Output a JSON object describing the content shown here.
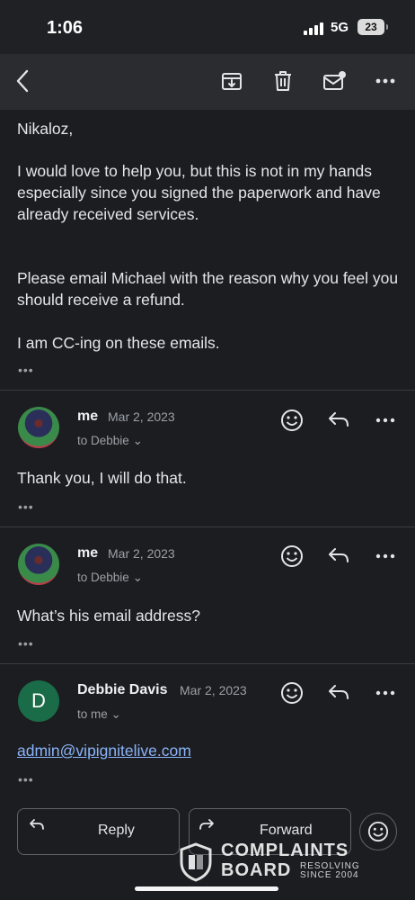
{
  "status_bar": {
    "time": "1:06",
    "network": "5G",
    "battery": "23"
  },
  "toolbar": {
    "back_icon": "chevron-left-icon",
    "archive_icon": "archive-icon",
    "delete_icon": "trash-icon",
    "mark_unread_icon": "mail-unread-icon",
    "more_icon": "more-horizontal-icon"
  },
  "first_message": {
    "lines": [
      "Nikaloz,",
      "I would love to help you, but this is not in my hands especially since you signed the paperwork and have already received services.",
      "Please email Michael with the reason why you feel you should receive a refund.",
      "I am CC-ing on these emails."
    ]
  },
  "messages": [
    {
      "sender": "me",
      "date": "Mar 2, 2023",
      "recipient": "to Debbie",
      "body": "Thank you, I will do that."
    },
    {
      "sender": "me",
      "date": "Mar 2, 2023",
      "recipient": "to Debbie",
      "body": "What’s his email address?"
    },
    {
      "sender": "Debbie Davis",
      "avatar_letter": "D",
      "date": "Mar 2, 2023",
      "recipient": "to me",
      "body": "admin@vipignitelive.com"
    }
  ],
  "ellipsis": "•••",
  "actions": {
    "reply": "Reply",
    "forward": "Forward"
  },
  "watermark": {
    "line1": "COMPLAINTS",
    "line2": "BOARD",
    "tag1": "RESOLVING",
    "tag2": "SINCE 2004"
  },
  "colors": {
    "background": "#1c1d21",
    "toolbar": "#2b2c30",
    "link": "#8ab4f8",
    "avatar_d": "#1a6b47"
  }
}
